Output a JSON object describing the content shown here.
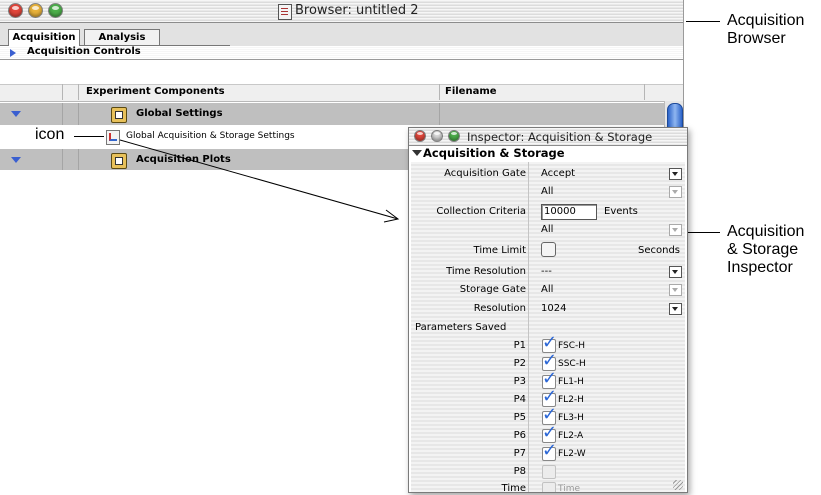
{
  "browser": {
    "title": "Browser: untitled 2",
    "tabs": [
      {
        "label": "Acquisition",
        "active": true
      },
      {
        "label": "Analysis",
        "active": false
      }
    ],
    "section_label": "Acquisition Controls",
    "columns": {
      "components": "Experiment Components",
      "filename": "Filename"
    },
    "rows": {
      "global_settings": "Global Settings",
      "global_acq_storage": "Global Acquisition & Storage Settings",
      "acquisition_plots": "Acquisition Plots"
    }
  },
  "inspector": {
    "title": "Inspector: Acquisition & Storage",
    "section_label": "Acquisition & Storage",
    "fields": {
      "acquisition_gate": {
        "label": "Acquisition Gate",
        "value": "Accept",
        "sub_value": "All"
      },
      "collection_criteria": {
        "label": "Collection Criteria",
        "value": "10000",
        "unit": "Events",
        "sub_value": "All"
      },
      "time_limit": {
        "label": "Time Limit",
        "unit": "Seconds"
      },
      "time_resolution": {
        "label": "Time Resolution",
        "value": "---"
      },
      "storage_gate": {
        "label": "Storage Gate",
        "value": "All"
      },
      "resolution": {
        "label": "Resolution",
        "value": "1024"
      }
    },
    "parameters_label": "Parameters Saved",
    "parameters": [
      {
        "id": "P1",
        "name": "FSC-H",
        "checked": true
      },
      {
        "id": "P2",
        "name": "SSC-H",
        "checked": true
      },
      {
        "id": "P3",
        "name": "FL1-H",
        "checked": true
      },
      {
        "id": "P4",
        "name": "FL2-H",
        "checked": true
      },
      {
        "id": "P5",
        "name": "FL3-H",
        "checked": true
      },
      {
        "id": "P6",
        "name": "FL2-A",
        "checked": true
      },
      {
        "id": "P7",
        "name": "FL2-W",
        "checked": true
      },
      {
        "id": "P8",
        "name": "",
        "checked": false
      },
      {
        "id": "Time",
        "name": "Time",
        "checked": false
      }
    ]
  },
  "callouts": {
    "icon": "icon",
    "browser_line1": "Acquisition",
    "browser_line2": "Browser",
    "inspector_line1": "Acquisition",
    "inspector_line2": "& Storage",
    "inspector_line3": "Inspector"
  },
  "colors": {
    "close": "#e2463b",
    "minimize": "#e8b23a",
    "zoom": "#4caf4a",
    "checkmark": "#2a66d6",
    "selection_row": "#bfbfbf"
  }
}
